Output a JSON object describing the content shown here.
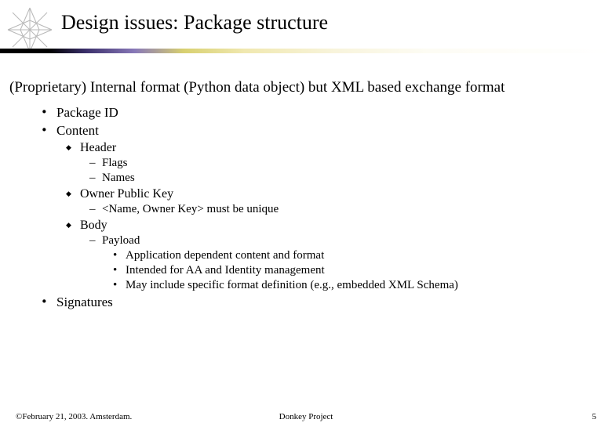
{
  "title": "Design issues: Package structure",
  "subtitle": "(Proprietary) Internal format (Python data object) but XML based exchange format",
  "bullets": {
    "b1": "Package ID",
    "b2": "Content",
    "b2_1": "Header",
    "b2_1_1": "Flags",
    "b2_1_2": "Names",
    "b2_2": "Owner Public Key",
    "b2_2_1": "<Name, Owner Key> must be unique",
    "b2_3": "Body",
    "b2_3_1": "Payload",
    "b2_3_1_1": "Application dependent content and format",
    "b2_3_1_2": "Intended for AA and Identity management",
    "b2_3_1_3": "May include specific format definition (e.g., embedded XML Schema)",
    "b3": "Signatures"
  },
  "footer": {
    "left": "©February 21, 2003. Amsterdam.",
    "center": "Donkey Project",
    "right": "5"
  }
}
